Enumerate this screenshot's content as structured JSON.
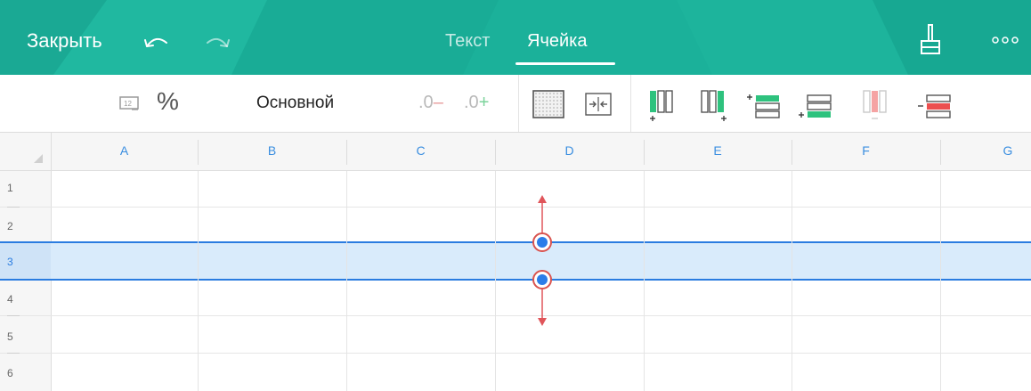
{
  "header": {
    "close_label": "Закрыть",
    "tabs": [
      {
        "label": "Текст",
        "active": false
      },
      {
        "label": "Ячейка",
        "active": true
      }
    ],
    "icons": [
      "undo-icon",
      "redo-icon",
      "brush-icon",
      "more-icon"
    ]
  },
  "toolbar": {
    "percent_label": "%",
    "number_format_label": "Основной",
    "decrease_decimals": {
      "digits": ".0",
      "sign": "–"
    },
    "increase_decimals": {
      "digits": ".0",
      "sign": "+"
    },
    "icons": [
      "number-format-icon",
      "cell-border-icon",
      "merge-cells-icon",
      "insert-column-left-icon",
      "insert-column-right-icon",
      "insert-row-above-icon",
      "insert-row-below-icon",
      "delete-column-icon",
      "delete-row-icon"
    ]
  },
  "sheet": {
    "columns": [
      "A",
      "B",
      "C",
      "D",
      "E",
      "F",
      "G"
    ],
    "rows": [
      "1",
      "2",
      "3",
      "4",
      "5",
      "6"
    ],
    "selected_row": "3"
  },
  "colors": {
    "accent": "#1bb19a",
    "selection": "#2a7ce0",
    "selection_fill": "#d9ebfb",
    "handle_ring": "#d9534f"
  }
}
